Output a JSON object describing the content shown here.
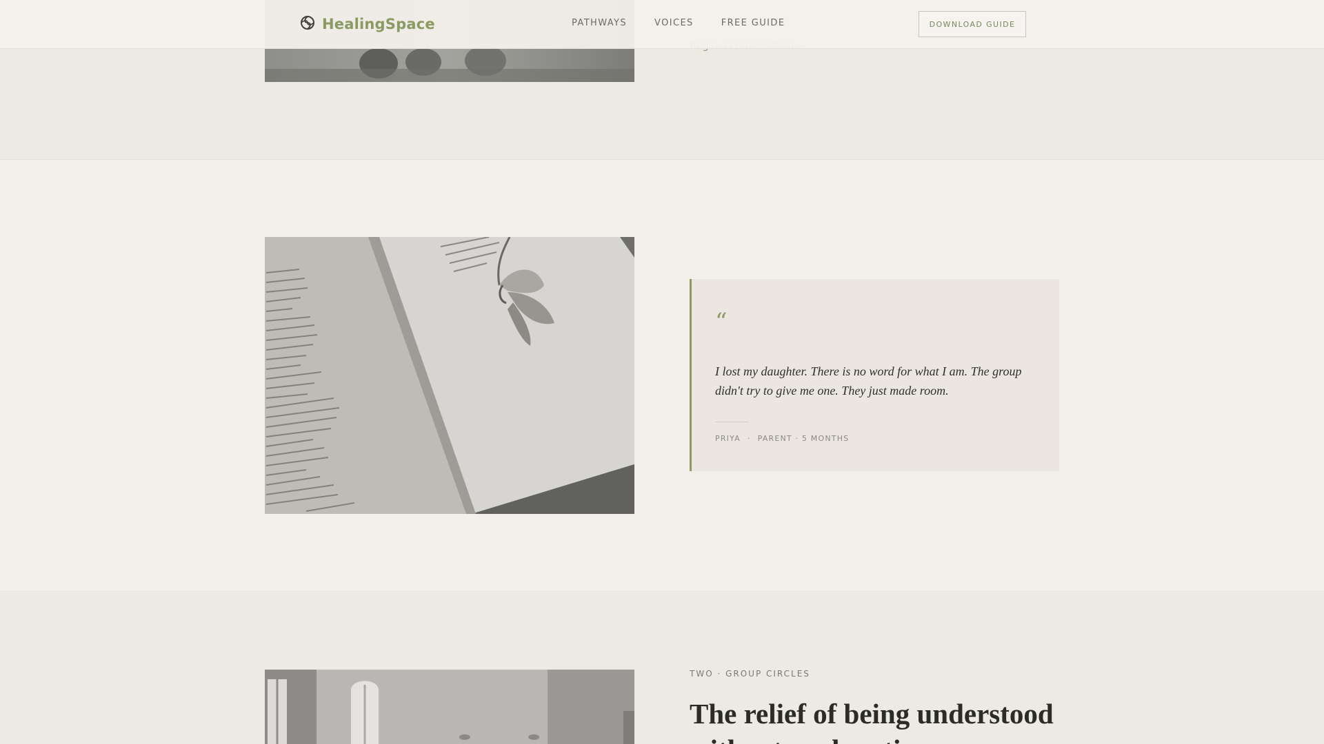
{
  "colors": {
    "accent": "#8a9a62",
    "background": "#f3f0eb",
    "band": "#edeae4",
    "card": "#ebe7e0",
    "text": "#2f2f2b"
  },
  "header": {
    "brand": "HealingSpace",
    "brand_icon": "spiral-logo-icon",
    "nav": [
      "PATHWAYS",
      "VOICES",
      "FREE GUIDE"
    ],
    "cta": "DOWNLOAD GUIDE"
  },
  "top_section": {
    "link": "Begin a conversation →"
  },
  "testimonial": {
    "quote_mark": "“",
    "quote": "I lost my daughter. There is no word for what I am. The group didn't try to give me one. They just made room.",
    "name": "PRIYA",
    "separator": "·",
    "role": "PARENT · 5 MONTHS"
  },
  "section_two": {
    "eyebrow": "TWO · GROUP CIRCLES",
    "heading": "The relief of being understood without explanation"
  }
}
